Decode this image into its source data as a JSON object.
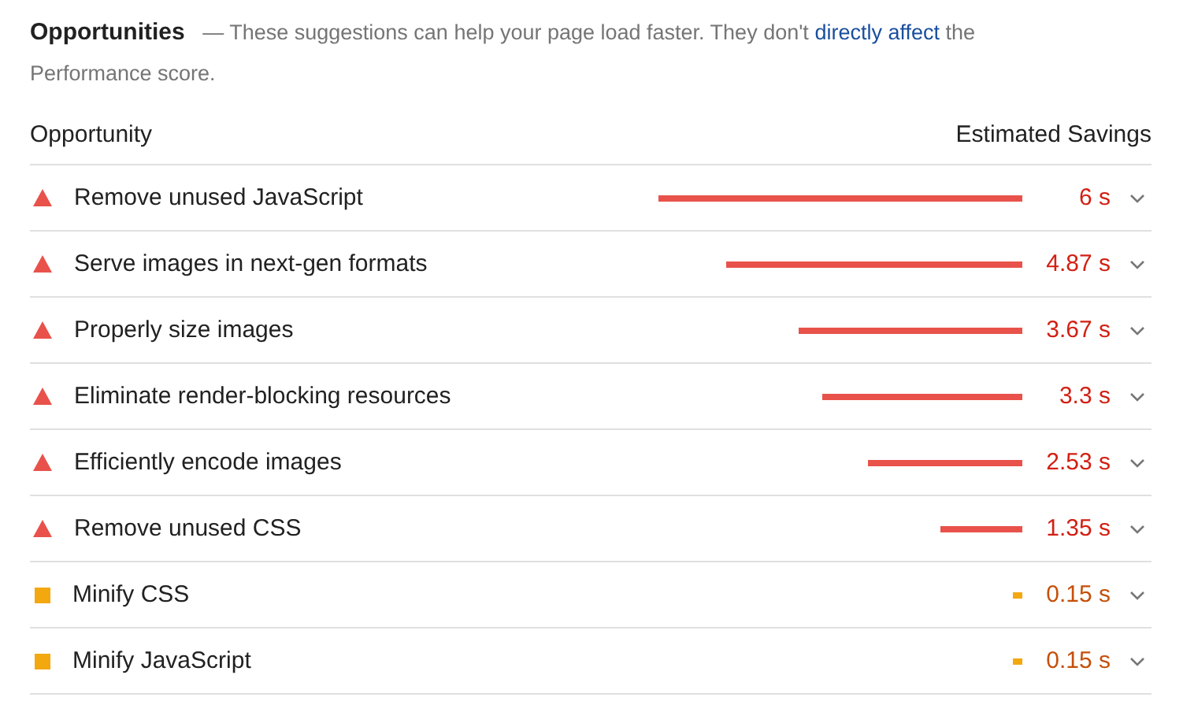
{
  "section": {
    "title": "Opportunities",
    "dash": "—",
    "description": "These suggestions can help your page load faster. They don't ",
    "link": "directly affect",
    "description_end": " the Performance score."
  },
  "table": {
    "columns": [
      "Opportunity",
      "Estimated Savings"
    ],
    "rows": [
      {
        "kind": "fail",
        "title": "Remove unused JavaScript",
        "savings": "6 s",
        "expanded": false
      },
      {
        "kind": "fail",
        "title": "Serve images in next-gen formats",
        "savings": "4.87 s",
        "expanded": false
      },
      {
        "kind": "fail",
        "title": "Properly size images",
        "savings": "3.67 s",
        "expanded": false
      },
      {
        "kind": "fail",
        "title": "Eliminate render-blocking resources",
        "savings": "3.3 s",
        "expanded": false
      },
      {
        "kind": "fail",
        "title": "Efficiently encode images",
        "savings": "2.53 s",
        "expanded": false
      },
      {
        "kind": "fail",
        "title": "Remove unused CSS",
        "savings": "1.35 s",
        "expanded": false
      },
      {
        "kind": "average",
        "title": "Minify CSS",
        "savings": "0.15 s",
        "expanded": false
      },
      {
        "kind": "average",
        "title": "Minify JavaScript",
        "savings": "0.15 s",
        "expanded": false
      }
    ]
  }
}
